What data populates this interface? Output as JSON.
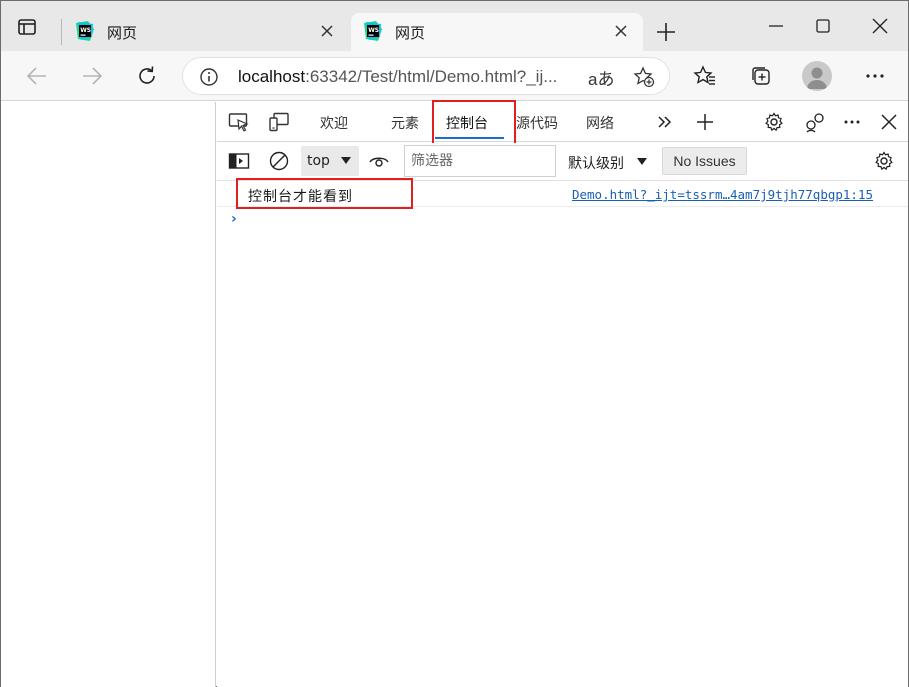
{
  "tabs": [
    {
      "title": "网页",
      "active": false
    },
    {
      "title": "网页",
      "active": true
    }
  ],
  "address": {
    "url_host": "localhost",
    "url_rest": ":63342/Test/html/Demo.html?_ij...",
    "read_aloud": "aあ"
  },
  "devtools": {
    "tabs": [
      "欢迎",
      "元素",
      "控制台",
      "源代码",
      "网络"
    ],
    "selected_tab": "控制台",
    "context": "top",
    "filter_placeholder": "筛选器",
    "levels": "默认级别",
    "issues": "No Issues",
    "console": {
      "message": "控制台才能看到",
      "source": "Demo.html?_ijt=tssrm…4am7j9tjh77qbgp1:15",
      "prompt": "›"
    }
  },
  "colors": {
    "highlight": "#e02020",
    "accent": "#1a6bd0",
    "link": "#1a5fb4"
  }
}
